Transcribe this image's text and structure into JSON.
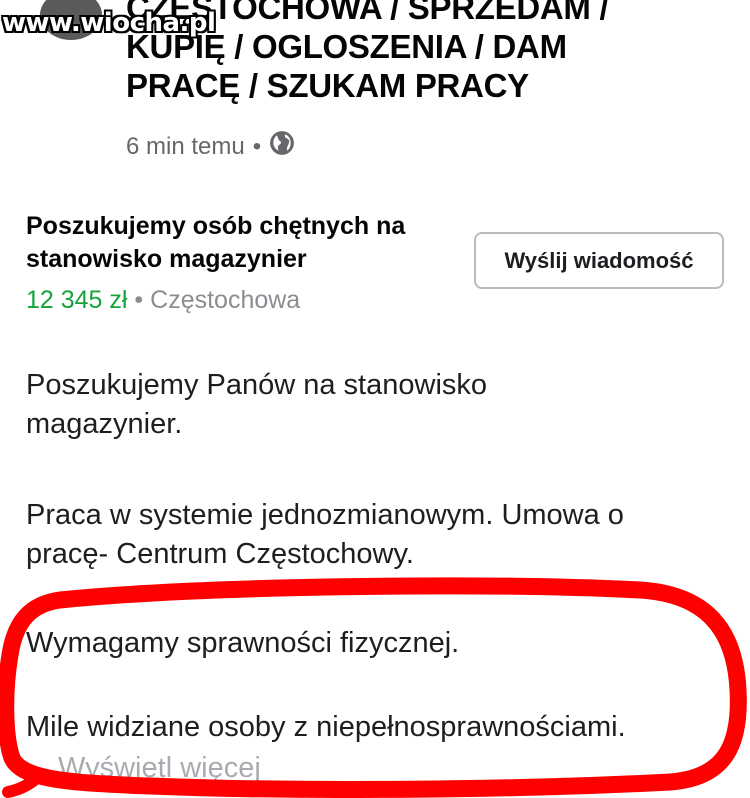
{
  "watermark": "www.wiocha.pl",
  "post": {
    "group_title_lines": [
      "CZĘSTOCHOWA / SPRZEDAM /",
      "KUPIĘ / OGLOSZENIA / DAM",
      "PRACĘ / SZUKAM PRACY"
    ],
    "time": "6 min temu",
    "separator": "•",
    "privacy_icon": "globe-icon"
  },
  "listing": {
    "title_lines": [
      "Poszukujemy osób chętnych na",
      "stanowisko magazynier"
    ],
    "price": "12 345 zł",
    "separator": "•",
    "location": "Częstochowa",
    "price_color": "#17a33b",
    "send_button_label": "Wyślij wiadomość"
  },
  "description": {
    "paragraph1_lines": [
      "Poszukujemy Panów na stanowisko",
      "magazynier."
    ],
    "paragraph2_lines": [
      "Praca w systemie jednozmianowym. Umowa o",
      "pracę- Centrum Częstochowy."
    ],
    "paragraph3": "Wymagamy sprawności fizycznej.",
    "paragraph4": "Mile widziane osoby z niepełnosprawnościami.",
    "see_more": "Wyświetl więcej"
  },
  "annotation_color": "#ff0000"
}
